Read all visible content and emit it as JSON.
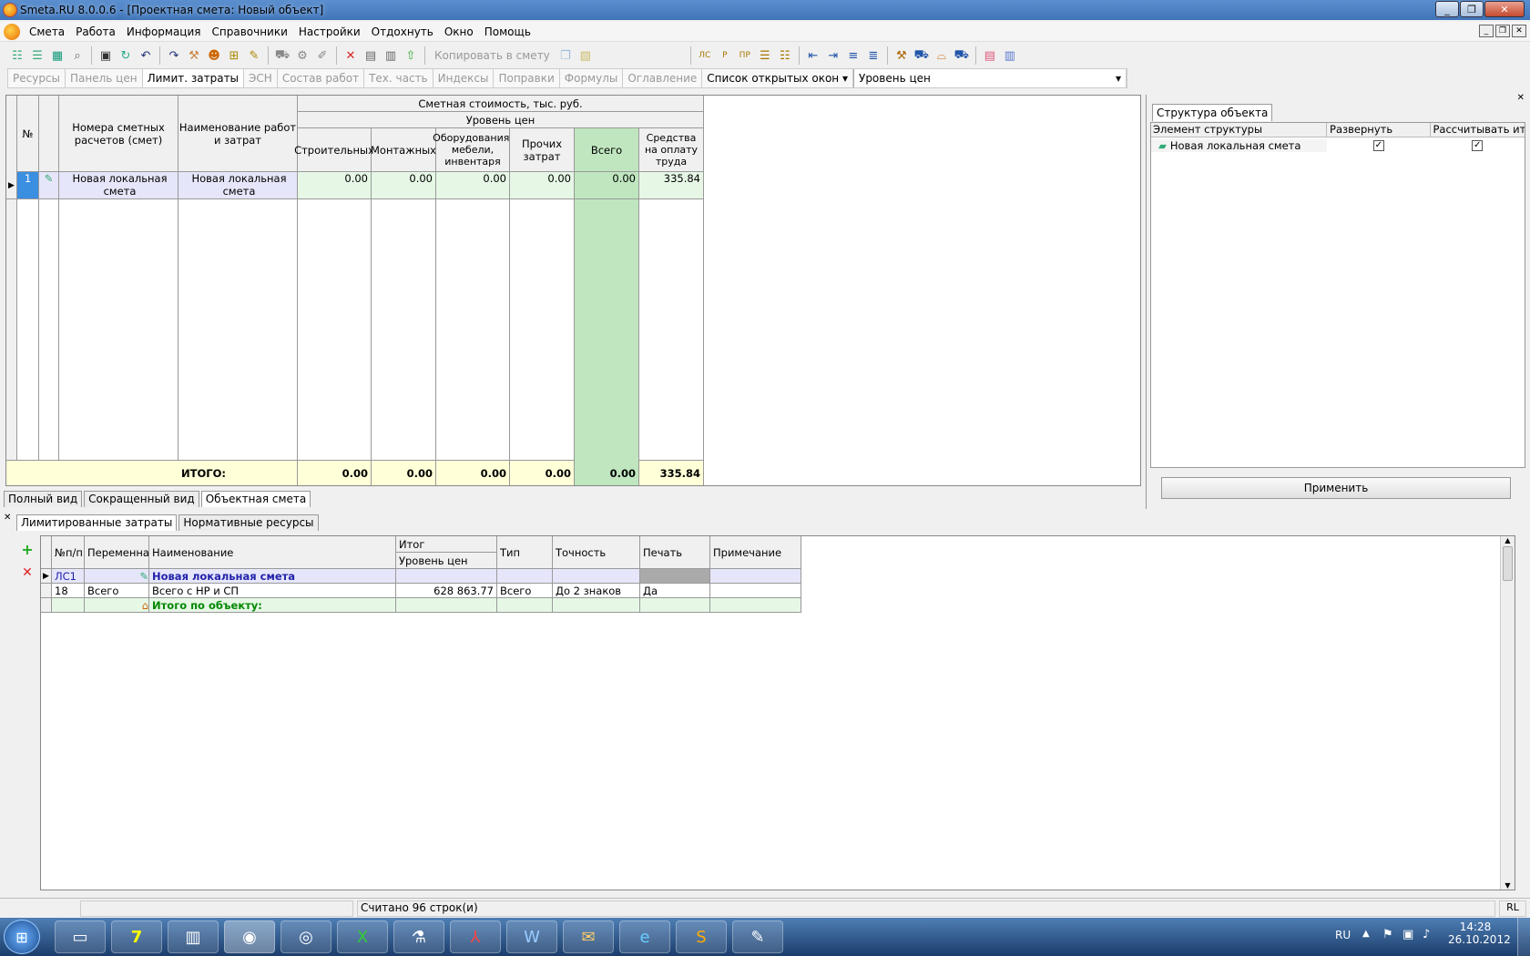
{
  "window": {
    "title": "Smeta.RU  8.0.0.6  - [Проектная смета: Новый объект]"
  },
  "menu": [
    "Смета",
    "Работа",
    "Информация",
    "Справочники",
    "Настройки",
    "Отдохнуть",
    "Окно",
    "Помощь"
  ],
  "toolbar": {
    "copy_label": "Копировать в смету"
  },
  "tabs2": {
    "items": [
      "Ресурсы",
      "Панель цен",
      "Лимит. затраты",
      "ЭСН",
      "Состав работ",
      "Тех. часть",
      "Индексы",
      "Поправки",
      "Формулы",
      "Оглавление"
    ],
    "open_windows": "Список открытых окон",
    "combo_value": "Уровень цен"
  },
  "main": {
    "headers": {
      "no": "№",
      "numbers": "Номера сметных расчетов (смет)",
      "name": "Наименование работ и затрат",
      "cost": "Сметная стоимость, тыс. руб.",
      "level": "Уровень цен",
      "c1": "Строительных",
      "c2": "Монтажных",
      "c3": "Оборудования, мебели, инвентаря",
      "c4": "Прочих затрат",
      "c5": "Всего",
      "c6": "Средства на оплату труда"
    },
    "row": {
      "n": "1",
      "num": "Новая локальная смета",
      "name": "Новая локальная смета",
      "v1": "0.00",
      "v2": "0.00",
      "v3": "0.00",
      "v4": "0.00",
      "v5": "0.00",
      "v6": "335.84"
    },
    "total": {
      "label": "ИТОГО:",
      "v1": "0.00",
      "v2": "0.00",
      "v3": "0.00",
      "v4": "0.00",
      "v5": "0.00",
      "v6": "335.84"
    }
  },
  "rpanel": {
    "tab": "Структура объекта",
    "h1": "Элемент структуры",
    "h2": "Развернуть",
    "h3": "Рассчитывать ит...",
    "item": "Новая локальная смета",
    "apply": "Применить"
  },
  "viewtabs": [
    "Полный вид",
    "Сокращенный вид",
    "Объектная смета"
  ],
  "btabs": [
    "Лимитированные затраты",
    "Нормативные ресурсы"
  ],
  "lower": {
    "headers": {
      "np": "№п/п",
      "var": "Переменная",
      "name": "Наименование",
      "itog": "Итог",
      "level": "Уровень цен",
      "type": "Тип",
      "prec": "Точность",
      "print": "Печать",
      "note": "Примечание"
    },
    "r1": {
      "np": "ЛС1",
      "name": "Новая локальная смета"
    },
    "r2": {
      "np": "18",
      "var": "Всего",
      "name": "Всего с НР и СП",
      "val": "628 863.77",
      "type": "Всего",
      "prec": "До 2 знаков",
      "print": "Да"
    },
    "r3": {
      "name": "Итого по объекту:"
    }
  },
  "status": {
    "text": "Считано 96 строк(и)",
    "lang": "RL"
  },
  "tray": {
    "lang": "RU",
    "time": "14:28",
    "date": "26.10.2012"
  }
}
